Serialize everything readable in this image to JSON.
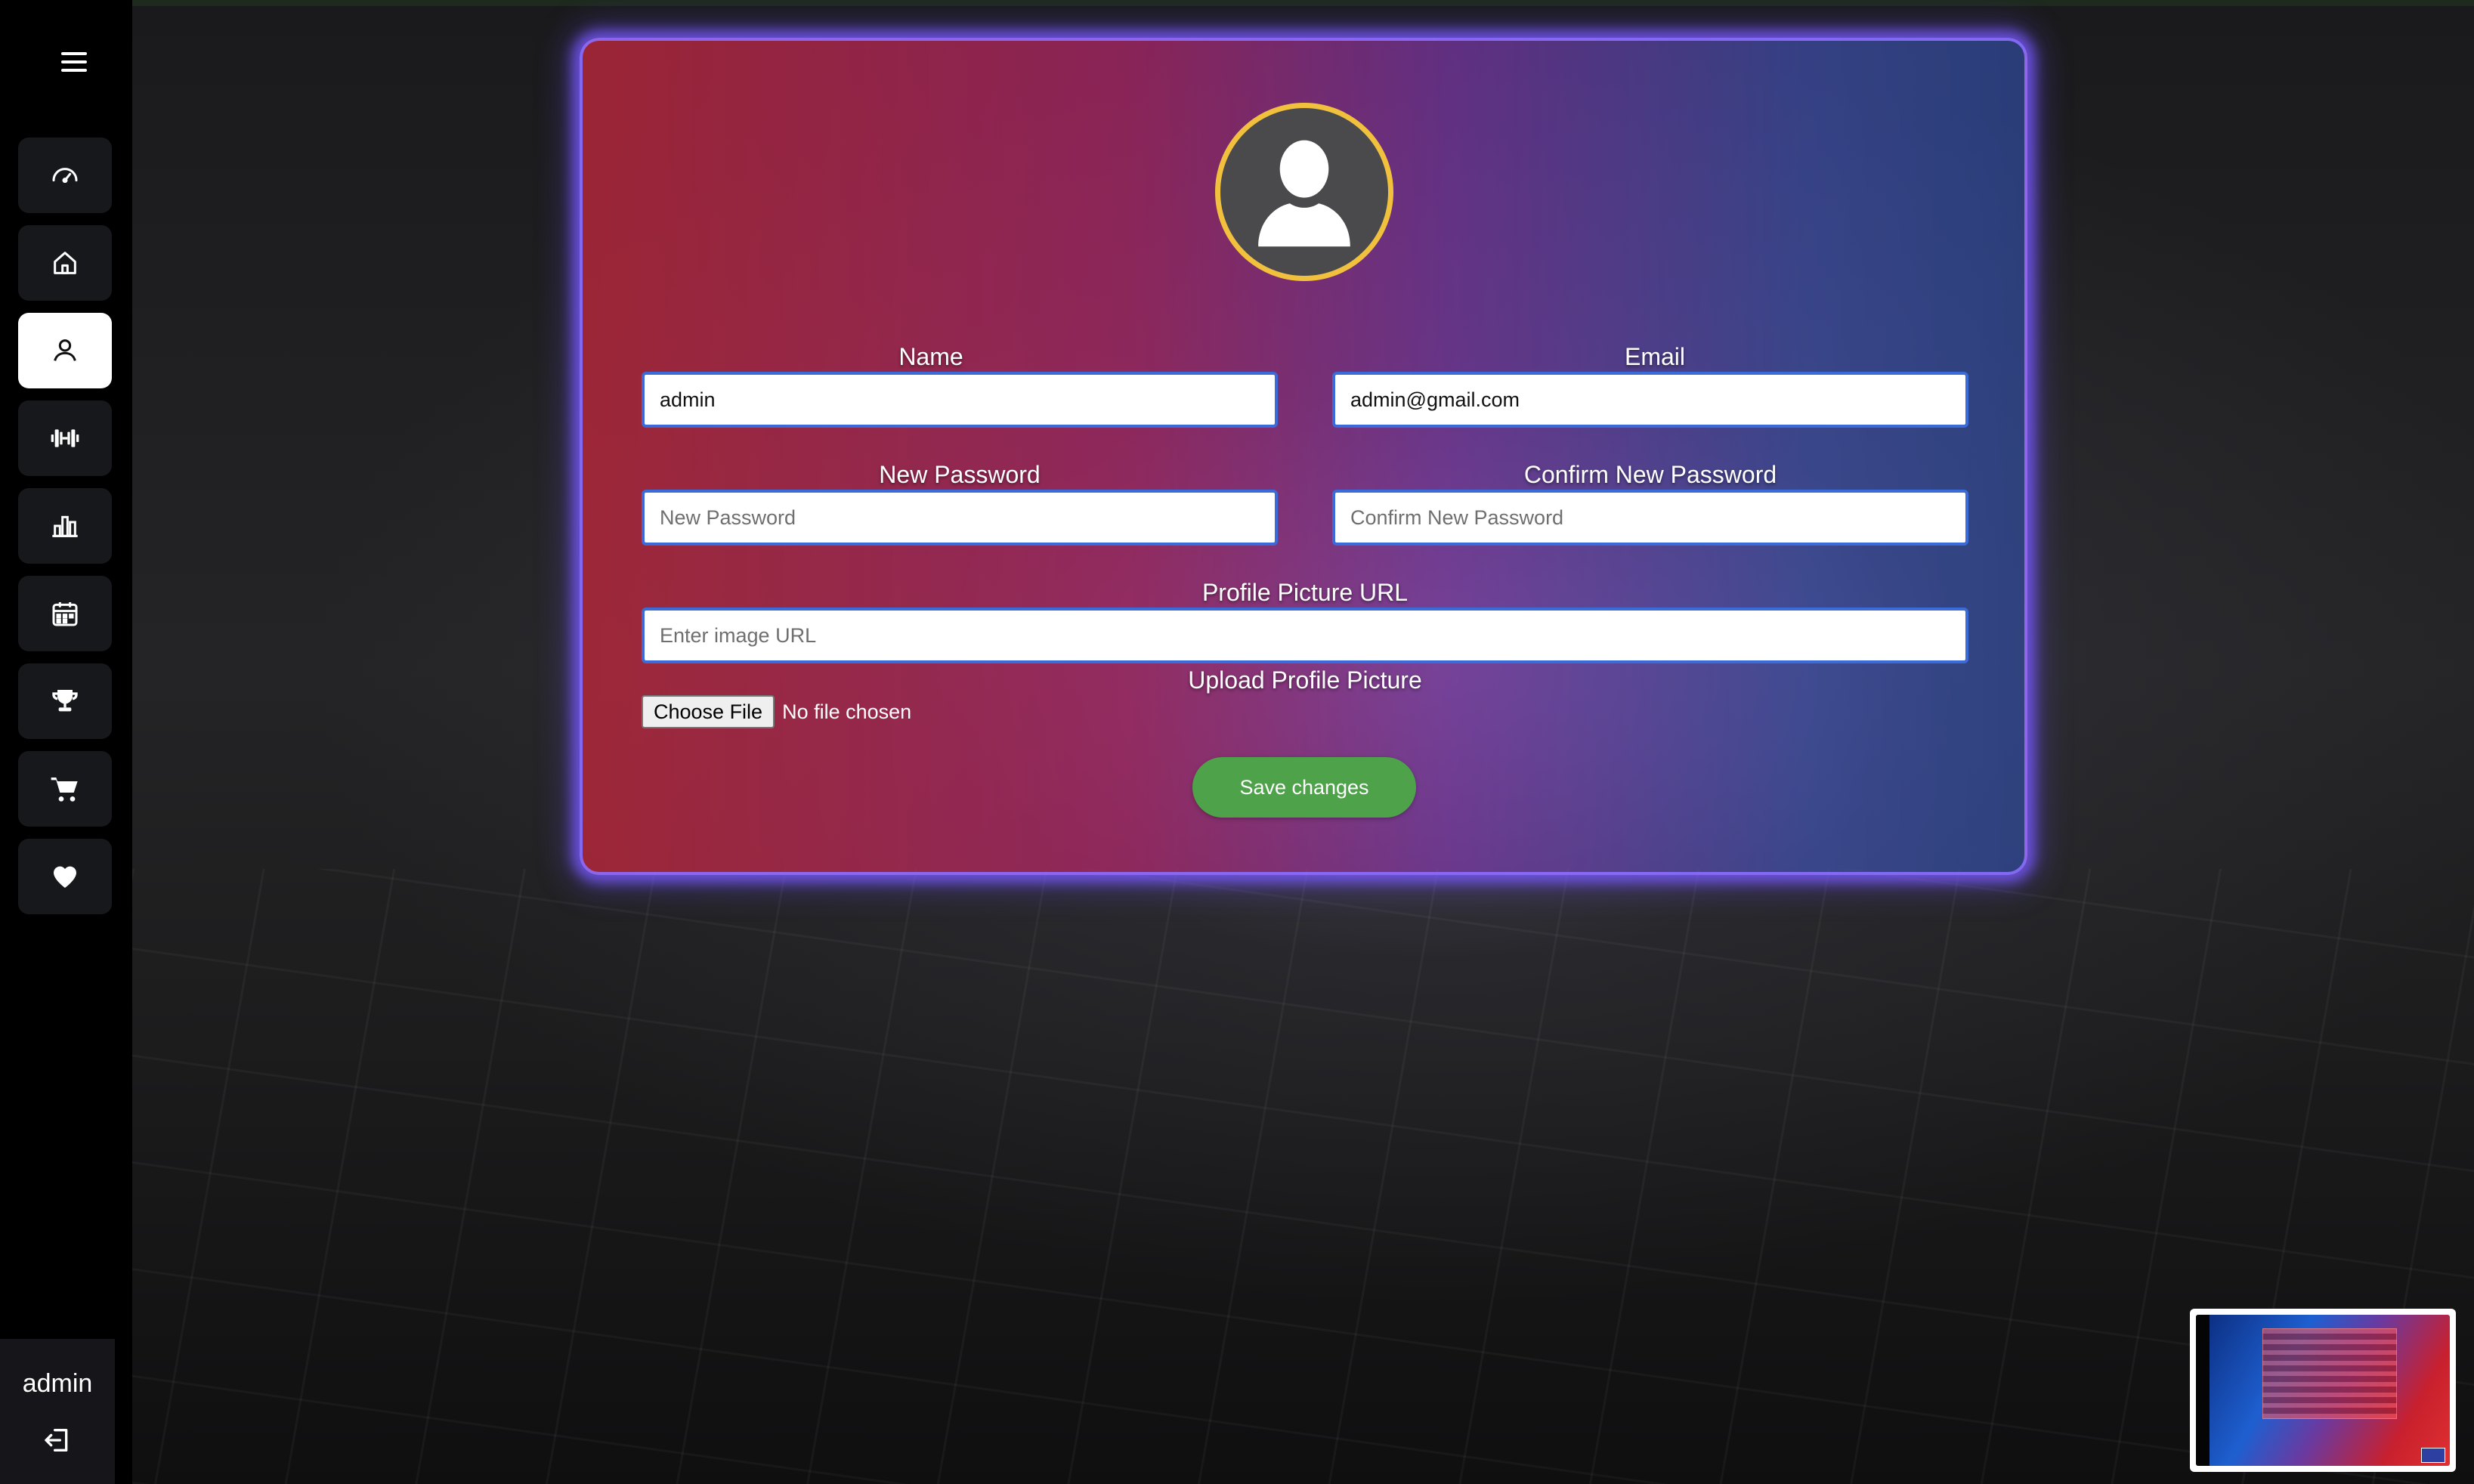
{
  "sidebar": {
    "menu_icon": "hamburger-icon",
    "items": [
      {
        "name": "dashboard",
        "icon": "speedometer-icon",
        "active": false
      },
      {
        "name": "home",
        "icon": "home-icon",
        "active": false
      },
      {
        "name": "profile",
        "icon": "user-icon",
        "active": true
      },
      {
        "name": "workouts",
        "icon": "dumbbell-icon",
        "active": false
      },
      {
        "name": "stats",
        "icon": "bar-chart-icon",
        "active": false
      },
      {
        "name": "calendar",
        "icon": "calendar-icon",
        "active": false
      },
      {
        "name": "achievements",
        "icon": "trophy-icon",
        "active": false
      },
      {
        "name": "shop",
        "icon": "cart-icon",
        "active": false
      },
      {
        "name": "favorites",
        "icon": "heart-icon",
        "active": false
      }
    ],
    "user": {
      "name": "admin",
      "logout_icon": "logout-icon"
    }
  },
  "profile_form": {
    "avatar_icon": "user-silhouette-icon",
    "name": {
      "label": "Name",
      "value": "admin"
    },
    "email": {
      "label": "Email",
      "value": "admin@gmail.com"
    },
    "new_password": {
      "label": "New Password",
      "placeholder": "New Password"
    },
    "confirm_password": {
      "label": "Confirm New Password",
      "placeholder": "Confirm New Password"
    },
    "picture_url": {
      "label": "Profile Picture URL",
      "placeholder": "Enter image URL"
    },
    "upload": {
      "label": "Upload Profile Picture",
      "button": "Choose File",
      "status": "No file chosen"
    },
    "save_label": "Save changes"
  },
  "colors": {
    "accent_glow": "#7b5cff",
    "avatar_ring": "#f1c13e",
    "save_button": "#4ea24a",
    "input_border": "#3a6bd8"
  }
}
